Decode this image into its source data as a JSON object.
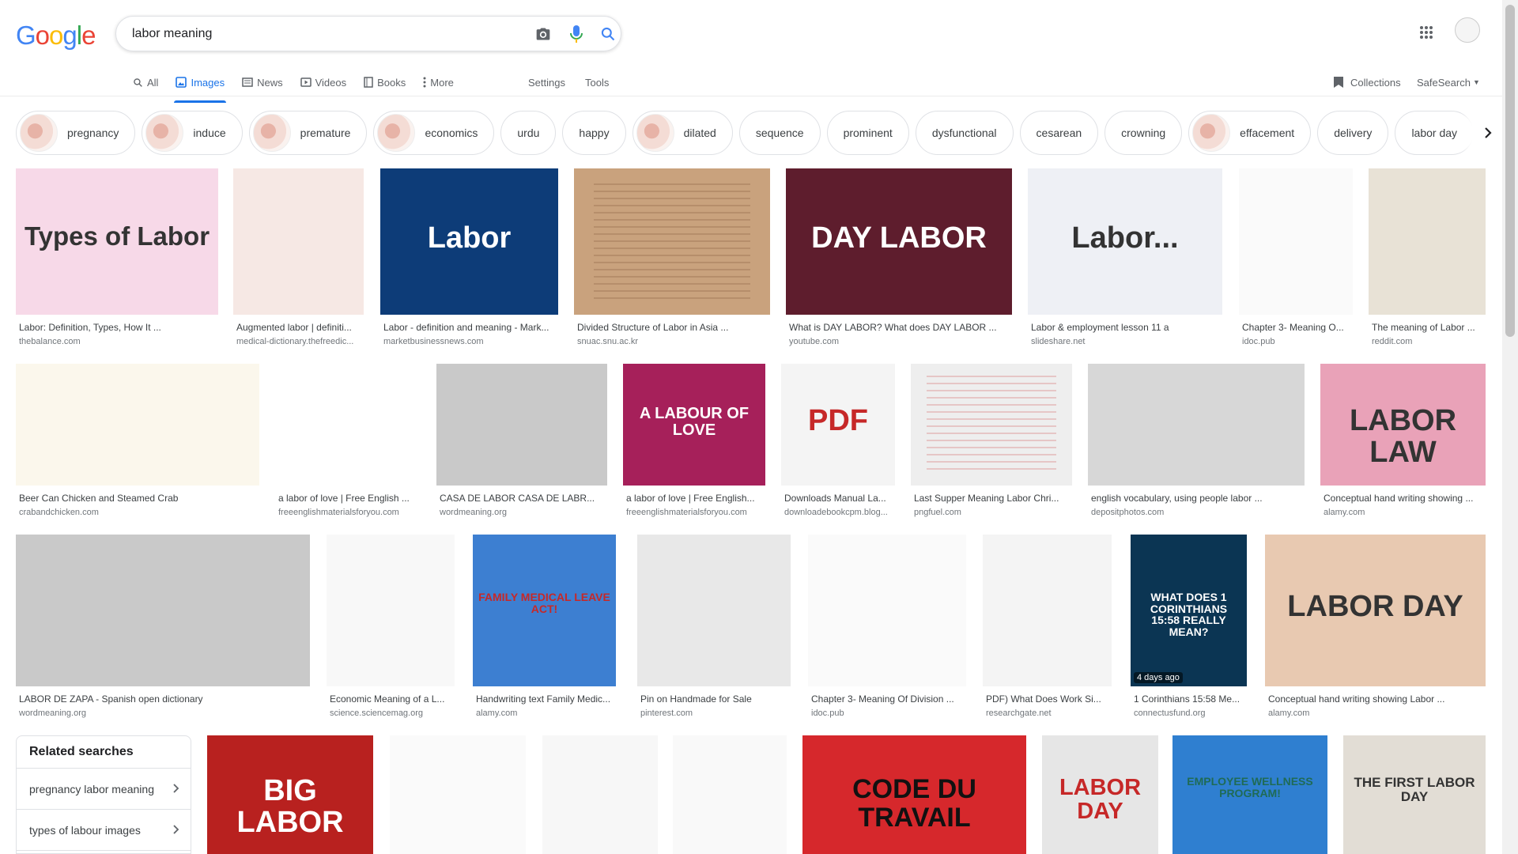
{
  "search": {
    "query": "labor meaning"
  },
  "logo": {
    "letters": [
      "G",
      "o",
      "o",
      "g",
      "l",
      "e"
    ],
    "colors": [
      "#4285f4",
      "#ea4335",
      "#fbbc05",
      "#4285f4",
      "#34a853",
      "#ea4335"
    ]
  },
  "tabs": [
    {
      "label": "All",
      "icon": "search-icon",
      "active": false
    },
    {
      "label": "Images",
      "icon": "image-icon",
      "active": true
    },
    {
      "label": "News",
      "icon": "news-icon",
      "active": false
    },
    {
      "label": "Videos",
      "icon": "video-icon",
      "active": false
    },
    {
      "label": "Books",
      "icon": "book-icon",
      "active": false
    },
    {
      "label": "More",
      "icon": "more-icon",
      "active": false
    }
  ],
  "tools": {
    "settings": "Settings",
    "tools": "Tools",
    "collections": "Collections",
    "safesearch": "SafeSearch"
  },
  "chips": [
    {
      "label": "pregnancy",
      "thumb": true
    },
    {
      "label": "induce",
      "thumb": true
    },
    {
      "label": "premature",
      "thumb": true
    },
    {
      "label": "economics",
      "thumb": true
    },
    {
      "label": "urdu",
      "thumb": false
    },
    {
      "label": "happy",
      "thumb": false
    },
    {
      "label": "dilated",
      "thumb": true
    },
    {
      "label": "sequence",
      "thumb": false
    },
    {
      "label": "prominent",
      "thumb": false
    },
    {
      "label": "dysfunctional",
      "thumb": false
    },
    {
      "label": "cesarean",
      "thumb": false
    },
    {
      "label": "crowning",
      "thumb": false
    },
    {
      "label": "effacement",
      "thumb": true
    },
    {
      "label": "delivery",
      "thumb": false
    },
    {
      "label": "labor day",
      "thumb": false
    }
  ],
  "results": [
    {
      "title": "Labor: Definition, Types, How It ...",
      "source": "thebalance.com",
      "overlay": "Types of Labor",
      "bg": "#f7d9e8",
      "fg": "#333"
    },
    {
      "title": "Augmented labor | definiti...",
      "source": "medical-dictionary.thefreedic...",
      "overlay": "",
      "bg": "#f6e8e4",
      "fg": "#b66"
    },
    {
      "title": "Labor - definition and meaning - Mark...",
      "source": "marketbusinessnews.com",
      "overlay": "Labor",
      "bg": "#0d3c78",
      "fg": "#fff"
    },
    {
      "title": "Divided Structure of Labor in Asia ...",
      "source": "snuac.snu.ac.kr",
      "overlay": "",
      "bg": "#c9a27d",
      "fg": "#6b3d22"
    },
    {
      "title": "What is DAY LABOR? What does DAY LABOR ...",
      "source": "youtube.com",
      "overlay": "DAY LABOR",
      "bg": "#5e1d2d",
      "fg": "#fff"
    },
    {
      "title": "Labor & employment lesson 11 a",
      "source": "slideshare.net",
      "overlay": "Labor...",
      "bg": "#eef0f5",
      "fg": "#333"
    },
    {
      "title": "Chapter 3- Meaning O...",
      "source": "idoc.pub",
      "overlay": "",
      "bg": "#fafafa",
      "fg": "#555"
    },
    {
      "title": "The meaning of Labor ...",
      "source": "reddit.com",
      "overlay": "",
      "bg": "#e8e2d6",
      "fg": "#555"
    },
    {
      "title": "Beer Can Chicken and Steamed Crab",
      "source": "crabandchicken.com",
      "overlay": "",
      "bg": "#fbf7ec",
      "fg": "#444"
    },
    {
      "title": "a labor of love | Free English ...",
      "source": "freeenglishmaterialsforyou.com",
      "overlay": "",
      "bg": "#ffffff",
      "fg": "#444"
    },
    {
      "title": "CASA DE LABOR CASA DE LABR...",
      "source": "wordmeaning.org",
      "overlay": "",
      "bg": "#c9c9c9",
      "fg": "#222"
    },
    {
      "title": "a labor of love | Free English...",
      "source": "freeenglishmaterialsforyou.com",
      "overlay": "A LABOUR OF LOVE",
      "bg": "#a6205a",
      "fg": "#fff"
    },
    {
      "title": "Downloads Manual La...",
      "source": "downloadebookcpm.blog...",
      "overlay": "PDF",
      "bg": "#f4f4f4",
      "fg": "#c62828"
    },
    {
      "title": "Last Supper Meaning Labor Chri...",
      "source": "pngfuel.com",
      "overlay": "",
      "bg": "#eeeeee",
      "fg": "#c62828"
    },
    {
      "title": "english vocabulary, using people labor ...",
      "source": "depositphotos.com",
      "overlay": "",
      "bg": "#d7d7d7",
      "fg": "#333"
    },
    {
      "title": "Conceptual hand writing showing ...",
      "source": "alamy.com",
      "overlay": "LABOR LAW",
      "bg": "#e9a2b8",
      "fg": "#333"
    },
    {
      "title": "LABOR DE ZAPA - Spanish open dictionary",
      "source": "wordmeaning.org",
      "overlay": "",
      "bg": "#c9c9c9",
      "fg": "#222"
    },
    {
      "title": "Economic Meaning of a L...",
      "source": "science.sciencemag.org",
      "overlay": "",
      "bg": "#f8f8f8",
      "fg": "#555"
    },
    {
      "title": "Handwriting text Family Medic...",
      "source": "alamy.com",
      "overlay": "FAMILY MEDICAL LEAVE ACT!",
      "bg": "#3d7fd1",
      "fg": "#c62828"
    },
    {
      "title": "Pin on Handmade for Sale",
      "source": "pinterest.com",
      "overlay": "",
      "bg": "#e8e8e8",
      "fg": "#333"
    },
    {
      "title": "Chapter 3- Meaning Of Division ...",
      "source": "idoc.pub",
      "overlay": "",
      "bg": "#fafafa",
      "fg": "#555"
    },
    {
      "title": "PDF) What Does Work Si...",
      "source": "researchgate.net",
      "overlay": "",
      "bg": "#f4f4f4",
      "fg": "#555"
    },
    {
      "title": "1 Corinthians 15:58 Me...",
      "source": "connectusfund.org",
      "overlay": "WHAT DOES 1 CORINTHIANS 15:58 REALLY MEAN?",
      "bg": "#0b3553",
      "fg": "#fff",
      "badge": "4 days ago"
    },
    {
      "title": "Conceptual hand writing showing Labor ...",
      "source": "alamy.com",
      "overlay": "LABOR DAY",
      "bg": "#e8c9b1",
      "fg": "#333"
    },
    {
      "title": "",
      "source": "",
      "overlay": "BIG LABOR",
      "bg": "#b8211f",
      "fg": "#fff"
    },
    {
      "title": "",
      "source": "",
      "overlay": "",
      "bg": "#fafafa",
      "fg": "#555"
    },
    {
      "title": "",
      "source": "",
      "overlay": "",
      "bg": "#f7f7f7",
      "fg": "#555"
    },
    {
      "title": "",
      "source": "",
      "overlay": "",
      "bg": "#f9f9f9",
      "fg": "#555"
    },
    {
      "title": "",
      "source": "",
      "overlay": "CODE DU TRAVAIL",
      "bg": "#d6282c",
      "fg": "#111"
    },
    {
      "title": "",
      "source": "",
      "overlay": "LABOR DAY",
      "bg": "#e6e6e6",
      "fg": "#c62828"
    },
    {
      "title": "",
      "source": "",
      "overlay": "EMPLOYEE WELLNESS PROGRAM!",
      "bg": "#2f7fd0",
      "fg": "#1f6b55"
    },
    {
      "title": "",
      "source": "",
      "overlay": "THE FIRST LABOR DAY",
      "bg": "#e2ddd5",
      "fg": "#333"
    }
  ],
  "related": {
    "title": "Related searches",
    "items": [
      {
        "label": "pregnancy labor meaning"
      },
      {
        "label": "types of labour images"
      }
    ]
  }
}
